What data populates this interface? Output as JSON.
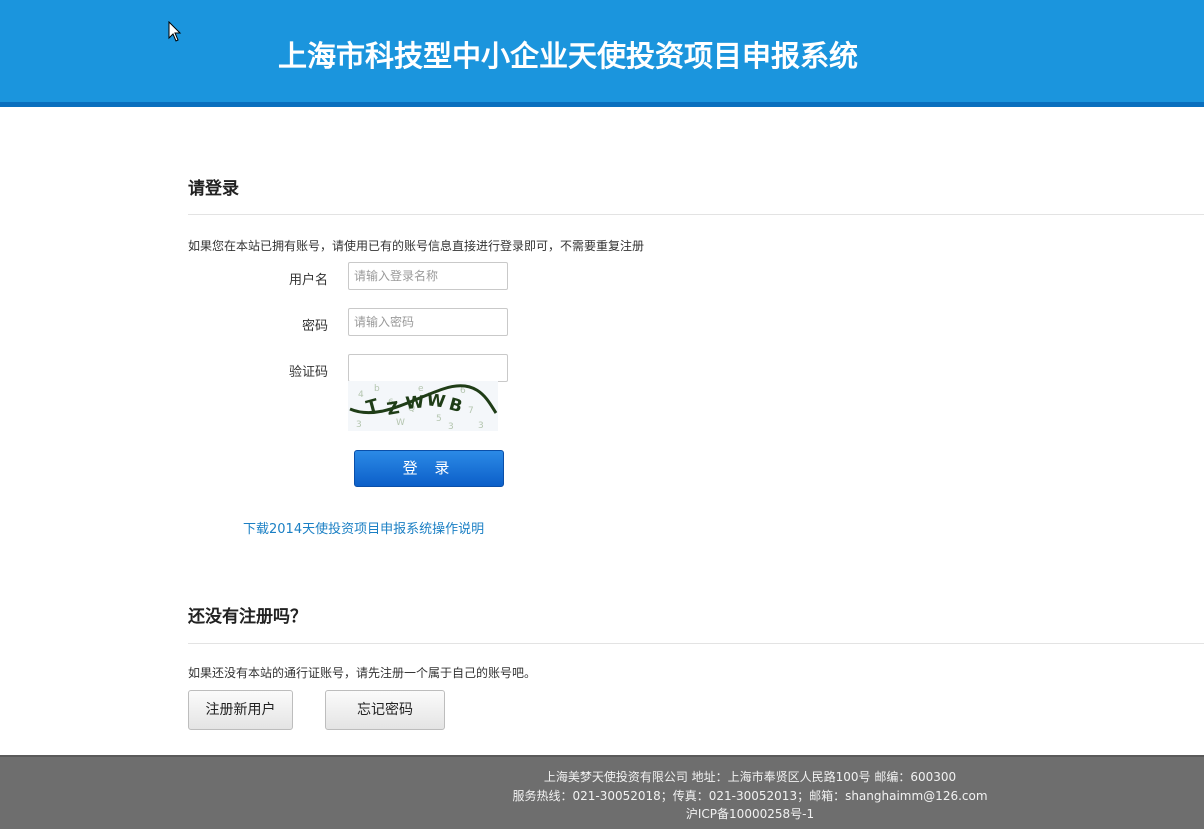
{
  "header": {
    "title": "上海市科技型中小企业天使投资项目申报系统"
  },
  "login": {
    "heading": "请登录",
    "note": "如果您在本站已拥有账号，请使用已有的账号信息直接进行登录即可，不需要重复注册",
    "username_label": "用户名",
    "username_placeholder": "请输入登录名称",
    "password_label": "密码",
    "password_placeholder": "请输入密码",
    "captcha_label": "验证码",
    "captcha_value": "",
    "submit_label": "登 录",
    "download_link": "下载2014天使投资项目申报系统操作说明"
  },
  "register": {
    "heading": "还没有注册吗？",
    "note": "如果还没有本站的通行证账号，请先注册一个属于自己的账号吧。",
    "register_button": "注册新用户",
    "forgot_button": "忘记密码"
  },
  "footer": {
    "line1": "上海美梦天使投资有限公司 地址：上海市奉贤区人民路100号 邮编：600300",
    "line2": "服务热线：021-30052018；传真：021-30052013；邮箱：shanghaimm@126.com",
    "line3": "沪ICP备10000258号-1"
  },
  "colors": {
    "header_bg": "#1b95dd",
    "login_button": "#0c5fc9",
    "link": "#1a7fc4",
    "footer_bg": "#6e6e6e"
  }
}
